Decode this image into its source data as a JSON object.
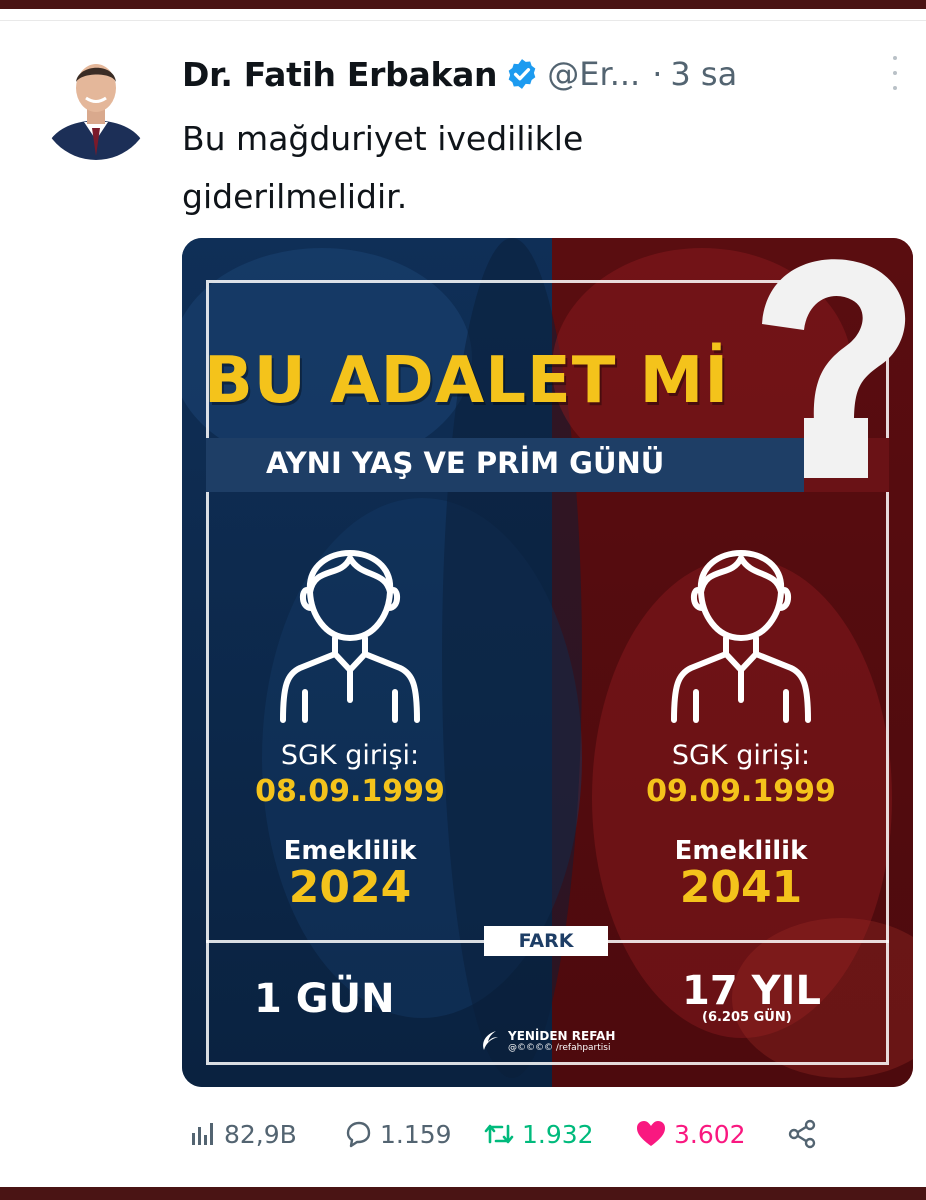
{
  "tweet": {
    "author_name": "Dr. Fatih Erbakan",
    "handle": "@Er...",
    "separator": "·",
    "time": "3 sa",
    "text_line1": "Bu mağduriyet ivedilikle",
    "text_line2": "giderilmelidir."
  },
  "media": {
    "headline": "BU ADALET Mİ",
    "subheadline": "AYNI YAŞ VE PRİM GÜNÜ",
    "left": {
      "sgk_label": "SGK girişi:",
      "sgk_date": "08.09.1999",
      "retirement_label": "Emeklilik",
      "retirement_year": "2024",
      "difference": "1 GÜN"
    },
    "right": {
      "sgk_label": "SGK girişi:",
      "sgk_date": "09.09.1999",
      "retirement_label": "Emeklilik",
      "retirement_year": "2041",
      "difference": "17 YIL",
      "difference_detail": "(6.205 GÜN)"
    },
    "difference_label": "FARK",
    "brand_name": "YENİDEN REFAH",
    "brand_social": "@©©©© /refahpartisi"
  },
  "actions": {
    "views": "82,9B",
    "replies": "1.159",
    "retweets": "1.932",
    "likes": "3.602"
  },
  "colors": {
    "retweet": "#00ba7c",
    "like": "#f91880",
    "verified": "#1d9bf0",
    "headline_yellow": "#f4c31b",
    "panel_blue": "#14365e",
    "panel_red": "#7d1418"
  }
}
